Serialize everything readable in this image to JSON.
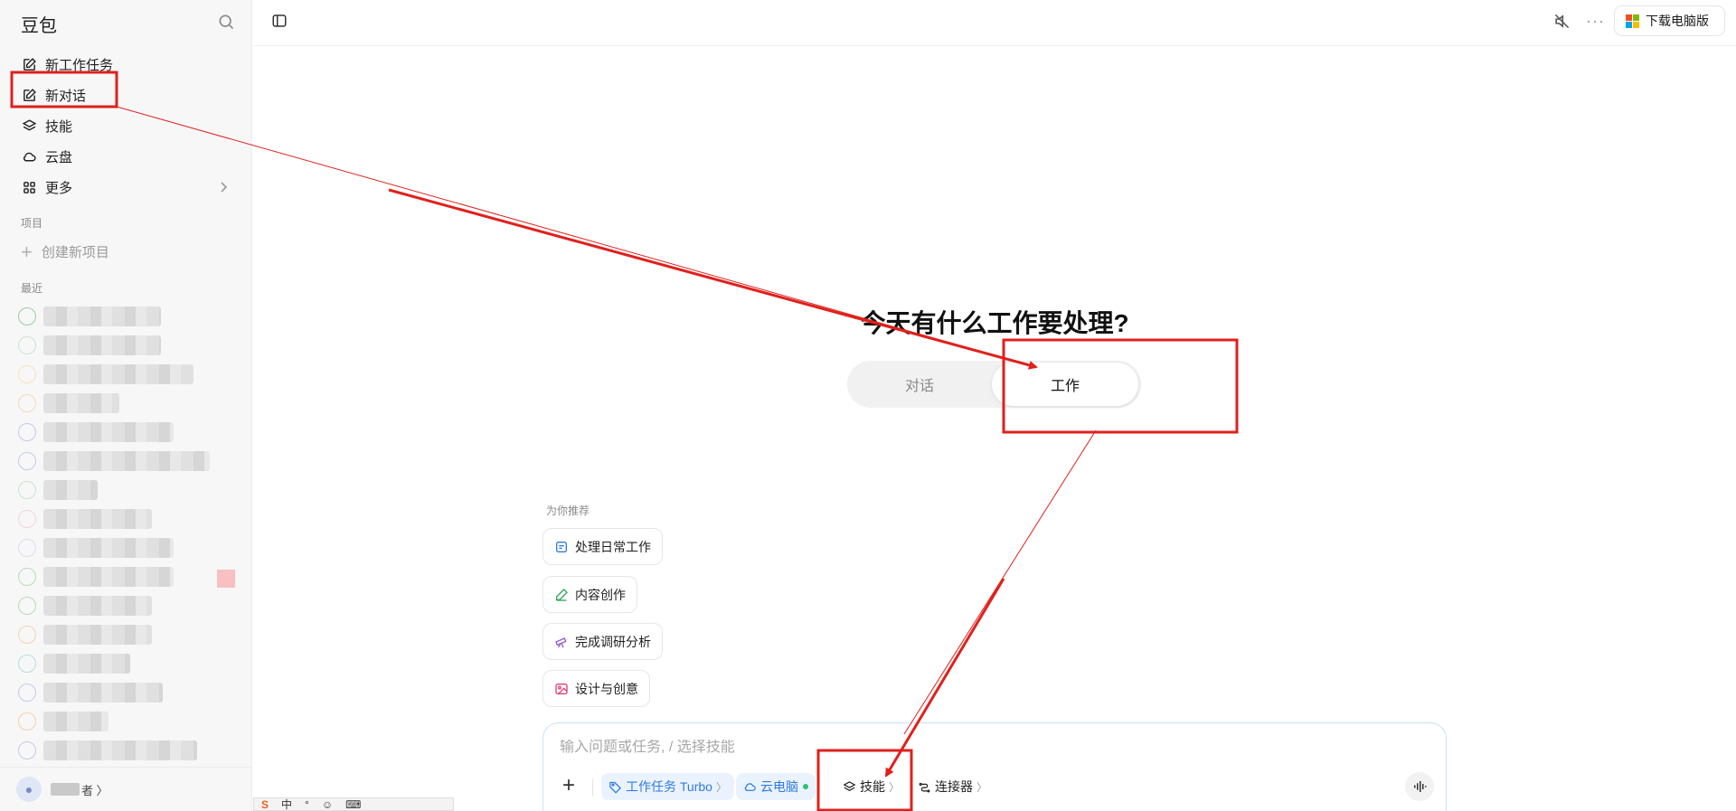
{
  "sidebar": {
    "brand": "豆包",
    "items": [
      {
        "label": "新工作任务",
        "icon": "edit-icon"
      },
      {
        "label": "新对话",
        "icon": "edit-icon"
      },
      {
        "label": "技能",
        "icon": "layers-icon"
      },
      {
        "label": "云盘",
        "icon": "cloud-icon"
      },
      {
        "label": "更多",
        "icon": "grid-icon"
      }
    ],
    "projects_label": "项目",
    "new_project": "创建新项目",
    "recent_label": "最近",
    "user_suffix": "者 〉"
  },
  "topbar": {
    "download_label": "下载电脑版",
    "more_label": "···"
  },
  "main": {
    "headline": "今天有什么工作要处理?",
    "mode_tabs": {
      "chat": "对话",
      "work": "工作"
    },
    "reco_label": "为你推荐",
    "chips": [
      "处理日常工作",
      "内容创作",
      "完成调研分析",
      "设计与创意"
    ]
  },
  "composer": {
    "placeholder": "输入问题或任务, / 选择技能",
    "work_task": "工作任务 Turbo",
    "cloud_pc": "云电脑",
    "skills": "技能",
    "connectors": "连接器"
  },
  "tray": {
    "items": [
      "中",
      "°",
      "☺",
      "⌨"
    ]
  },
  "colors": {
    "annotation": "#e0201c",
    "accent": "#2f7be0",
    "online": "#2fbf71"
  }
}
